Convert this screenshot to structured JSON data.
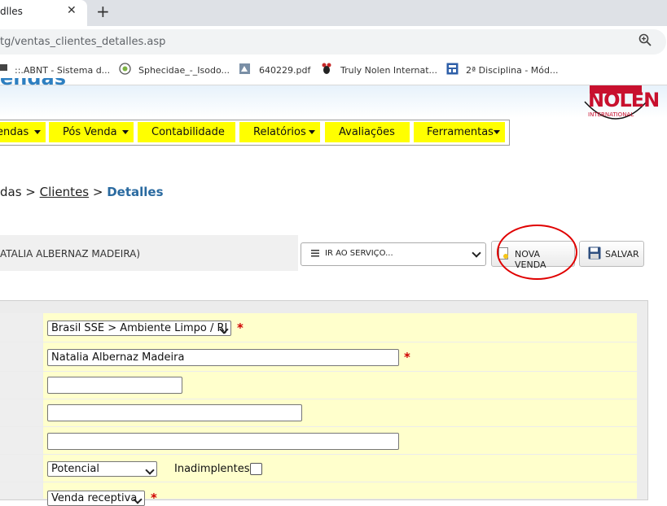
{
  "browser": {
    "tab_title": "dlles",
    "tab_close": "✕",
    "new_tab": "+",
    "url": "tg/ventas_clientes_detalles.asp",
    "bookmarks": [
      {
        "label": "::.ABNT - Sistema d...",
        "icon": "computer-icon"
      },
      {
        "label": "Sphecidae_-_Isodo...",
        "icon": "wikipedia-icon"
      },
      {
        "label": "640229.pdf",
        "icon": "pdf-icon"
      },
      {
        "label": "Truly Nolen Internat...",
        "icon": "mouse-icon"
      },
      {
        "label": "2ª Disciplina - Mód...",
        "icon": "grid-icon"
      }
    ]
  },
  "header": {
    "title": "endas",
    "logo_text": "NOLEN",
    "logo_sub": "INTERNATIONAL"
  },
  "menu": [
    {
      "label": "endas"
    },
    {
      "label": "Pós Venda"
    },
    {
      "label": "Contabilidade"
    },
    {
      "label": "Relatórios"
    },
    {
      "label": "Avaliações"
    },
    {
      "label": "Ferramentas"
    }
  ],
  "breadcrumb": {
    "part1": "das",
    "sep1": " > ",
    "part2": "Clientes",
    "sep2": " > ",
    "part3": "Detalles"
  },
  "actions": {
    "client_name": "ATALIA ALBERNAZ MADEIRA)",
    "service_select": "IR AO SERVIÇO...",
    "new_sale": "NOVA VENDA",
    "save": "SALVAR"
  },
  "form": {
    "region_select": "Brasil SSE > Ambiente Limpo / RJ",
    "name_value": "Natalia Albernaz Madeira",
    "status_select": "Potencial",
    "inadimplentes_label": "Inadimplentes:",
    "sale_type_select": "Venda receptiva",
    "required_mark": "*"
  },
  "colors": {
    "menu_bg": "#ffff00",
    "form_row_bg": "#ffffcc",
    "breadcrumb_current": "#2a6aa0",
    "annotation_circle": "#e00000"
  }
}
